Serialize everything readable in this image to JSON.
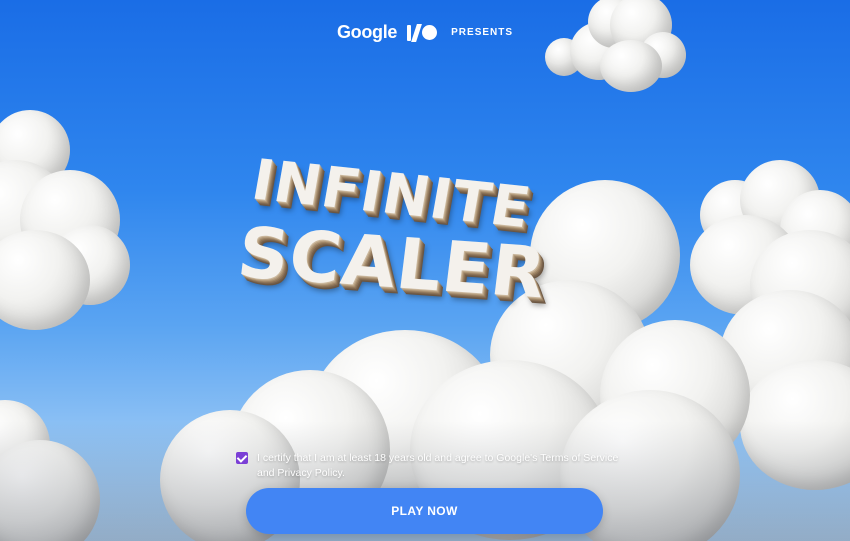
{
  "header": {
    "brand": "Google",
    "event_mark": "I/O",
    "presents": "PRESENTS"
  },
  "hero": {
    "title_line1": "INFINITE",
    "title_line2": "SCALER"
  },
  "consent": {
    "checked": true,
    "text": "I certify that I am at least 18 years old and agree to Google's Terms of Service and Privacy Policy."
  },
  "cta": {
    "play_label": "PLAY NOW"
  },
  "colors": {
    "sky_top": "#1a6de6",
    "accent_button": "#4285f4",
    "checkbox": "#7b3fd6"
  },
  "icons": [
    "google-io-logo-icon",
    "checkbox-checked-icon"
  ]
}
